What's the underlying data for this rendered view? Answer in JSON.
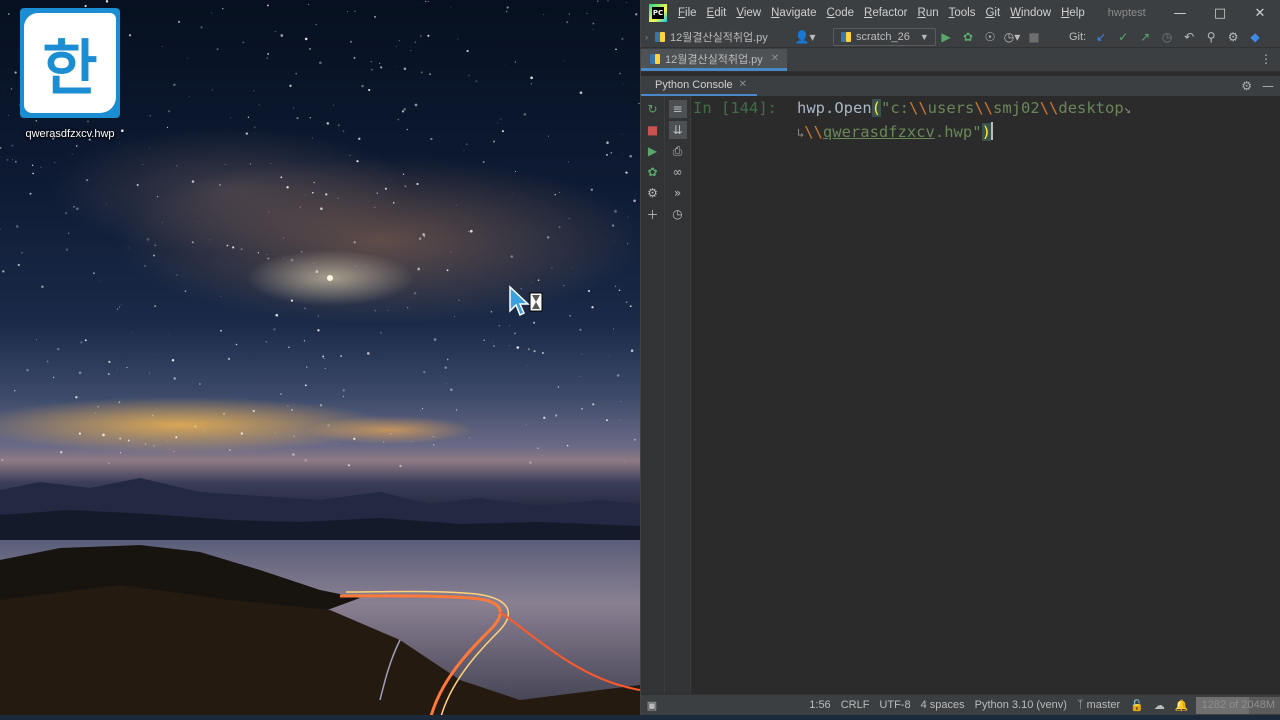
{
  "desktop": {
    "icon": {
      "glyph": "한",
      "label": "qwerasdfzxcv.hwp"
    }
  },
  "ide": {
    "menu": [
      {
        "key": "F",
        "rest": "ile"
      },
      {
        "key": "E",
        "rest": "dit"
      },
      {
        "key": "V",
        "rest": "iew"
      },
      {
        "key": "N",
        "rest": "avigate"
      },
      {
        "key": "C",
        "rest": "ode"
      },
      {
        "key": "R",
        "rest": "efactor"
      },
      {
        "key": "R",
        "rest": "un"
      },
      {
        "key": "T",
        "rest": "ools"
      },
      {
        "key": "G",
        "rest": "it"
      },
      {
        "key": "W",
        "rest": "indow"
      },
      {
        "key": "H",
        "rest": "elp"
      }
    ],
    "window_title": "hwptest",
    "breadcrumb_file": "12월결산실적취업.py",
    "run_config": "scratch_26",
    "git_label": "Git:",
    "editor_tab": "12월결산실적취업.py",
    "tool_tab": "Python Console",
    "console": {
      "prompt": "In [144]:",
      "line1": {
        "call": "hwp.Open",
        "open_paren": "(",
        "str_a": "\"c:",
        "esc1": "\\\\",
        "str_b": "users",
        "esc2": "\\\\",
        "str_c": "smj02",
        "esc3": "\\\\",
        "str_d": "desktop"
      },
      "line2": {
        "esc4": "\\\\",
        "str_e": "qwerasdfzxcv",
        "str_f": ".hwp\"",
        "close_paren": ")"
      }
    },
    "status": {
      "position": "1:56",
      "line_sep": "CRLF",
      "encoding": "UTF-8",
      "indent": "4 spaces",
      "interpreter": "Python 3.10 (venv)",
      "branch": "master",
      "memory": "1282 of 2048M",
      "memory_fraction": 0.626
    }
  }
}
